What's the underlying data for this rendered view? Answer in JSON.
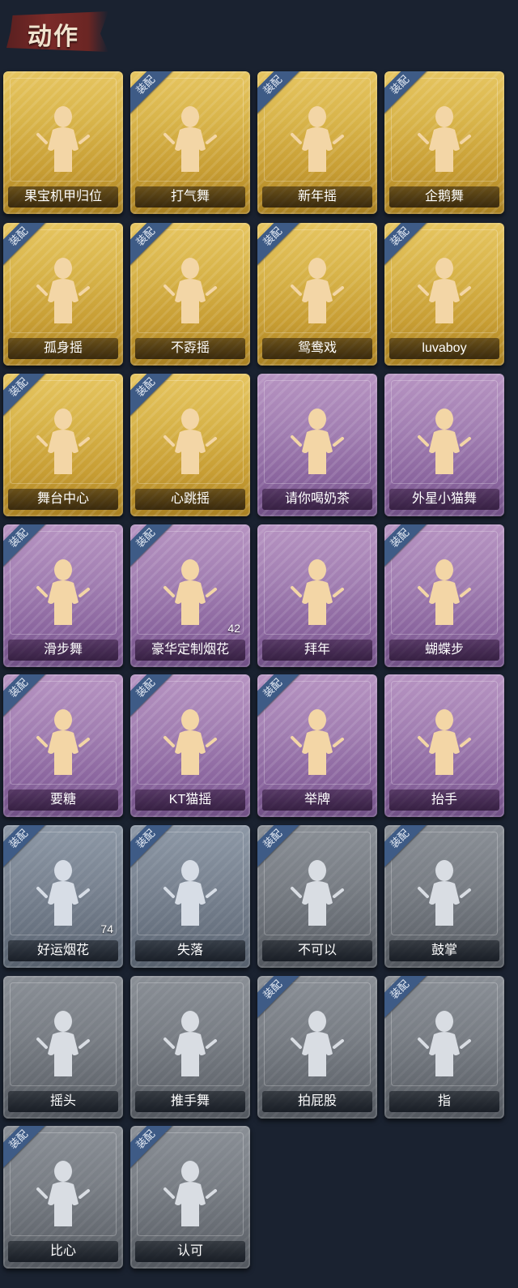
{
  "header": {
    "title": "动作"
  },
  "equip_label": "装配",
  "cards": [
    {
      "name": "果宝机甲归位",
      "tier": "gold",
      "equipped": false,
      "count": ""
    },
    {
      "name": "打气舞",
      "tier": "gold",
      "equipped": true,
      "count": ""
    },
    {
      "name": "新年摇",
      "tier": "gold",
      "equipped": true,
      "count": ""
    },
    {
      "name": "企鹅舞",
      "tier": "gold",
      "equipped": true,
      "count": ""
    },
    {
      "name": "孤身摇",
      "tier": "gold",
      "equipped": true,
      "count": ""
    },
    {
      "name": "不孬摇",
      "tier": "gold",
      "equipped": true,
      "count": ""
    },
    {
      "name": "鸳鸯戏",
      "tier": "gold",
      "equipped": true,
      "count": ""
    },
    {
      "name": "luvaboy",
      "tier": "gold",
      "equipped": true,
      "count": ""
    },
    {
      "name": "舞台中心",
      "tier": "gold",
      "equipped": true,
      "count": ""
    },
    {
      "name": "心跳摇",
      "tier": "gold",
      "equipped": true,
      "count": ""
    },
    {
      "name": "请你喝奶茶",
      "tier": "purple",
      "equipped": false,
      "count": ""
    },
    {
      "name": "外星小猫舞",
      "tier": "purple",
      "equipped": false,
      "count": ""
    },
    {
      "name": "滑步舞",
      "tier": "purple",
      "equipped": true,
      "count": ""
    },
    {
      "name": "豪华定制烟花",
      "tier": "purple",
      "equipped": true,
      "count": "42"
    },
    {
      "name": "拜年",
      "tier": "purple",
      "equipped": false,
      "count": ""
    },
    {
      "name": "蝴蝶步",
      "tier": "purple",
      "equipped": true,
      "count": ""
    },
    {
      "name": "要糖",
      "tier": "purple",
      "equipped": true,
      "count": ""
    },
    {
      "name": "KT猫摇",
      "tier": "purple",
      "equipped": true,
      "count": ""
    },
    {
      "name": "举牌",
      "tier": "purple",
      "equipped": true,
      "count": ""
    },
    {
      "name": "抬手",
      "tier": "purple",
      "equipped": false,
      "count": ""
    },
    {
      "name": "好运烟花",
      "tier": "silver",
      "equipped": true,
      "count": "74"
    },
    {
      "name": "失落",
      "tier": "silver",
      "equipped": true,
      "count": ""
    },
    {
      "name": "不可以",
      "tier": "grey",
      "equipped": true,
      "count": ""
    },
    {
      "name": "鼓掌",
      "tier": "grey",
      "equipped": true,
      "count": ""
    },
    {
      "name": "摇头",
      "tier": "grey",
      "equipped": false,
      "count": ""
    },
    {
      "name": "推手舞",
      "tier": "grey",
      "equipped": false,
      "count": ""
    },
    {
      "name": "拍屁股",
      "tier": "grey",
      "equipped": true,
      "count": ""
    },
    {
      "name": "指",
      "tier": "grey",
      "equipped": true,
      "count": ""
    },
    {
      "name": "比心",
      "tier": "grey",
      "equipped": true,
      "count": ""
    },
    {
      "name": "认可",
      "tier": "grey",
      "equipped": true,
      "count": ""
    }
  ]
}
